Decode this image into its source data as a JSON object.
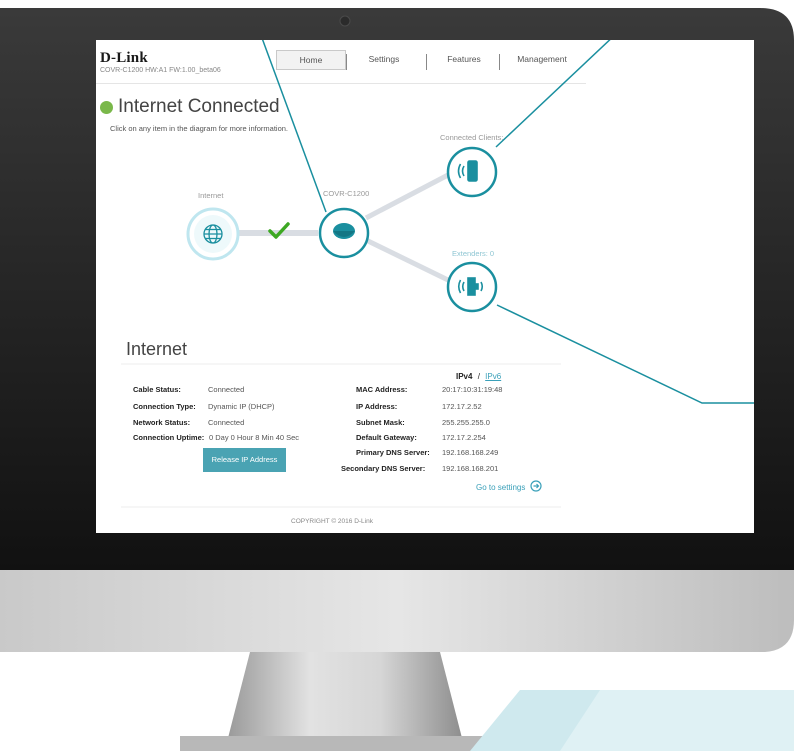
{
  "header": {
    "logo": "D-Link",
    "model_info": "COVR-C1200 HW:A1 FW:1.00_beta06",
    "nav": [
      "Home",
      "Settings",
      "Features",
      "Management"
    ]
  },
  "status": {
    "title": "Internet Connected",
    "hint": "Click on any item in the diagram for more information."
  },
  "diagram": {
    "internet_label": "Internet",
    "router_label": "COVR-C1200",
    "clients_label": "Connected Clients:",
    "extenders_label": "Extenders: 0"
  },
  "details": {
    "section_title": "Internet",
    "ipv4_label": "IPv4",
    "ipv_sep": "/",
    "ipv6_label": "IPv6",
    "left": [
      {
        "label": "Cable Status:",
        "value": "Connected"
      },
      {
        "label": "Connection Type:",
        "value": "Dynamic IP (DHCP)"
      },
      {
        "label": "Network Status:",
        "value": "Connected"
      },
      {
        "label": "Connection Uptime:",
        "value": "0 Day 0 Hour 8 Min 40 Sec"
      }
    ],
    "right": [
      {
        "label": "MAC Address:",
        "value": "20:17:10:31:19:48"
      },
      {
        "label": "IP Address:",
        "value": "172.17.2.52"
      },
      {
        "label": "Subnet Mask:",
        "value": "255.255.255.0"
      },
      {
        "label": "Default Gateway:",
        "value": "172.17.2.254"
      },
      {
        "label": "Primary DNS Server:",
        "value": "192.168.168.249"
      },
      {
        "label": "Secondary DNS Server:",
        "value": "192.168.168.201"
      }
    ],
    "release_button": "Release IP Address",
    "settings_link": "Go to settings"
  },
  "footer": {
    "copyright": "COPYRIGHT © 2016 D-Link"
  },
  "colors": {
    "accent": "#1a8f9f",
    "status_green": "#7ab84a",
    "check_green": "#3da823",
    "link": "#3aa0b9",
    "button": "#4aa3b3"
  }
}
